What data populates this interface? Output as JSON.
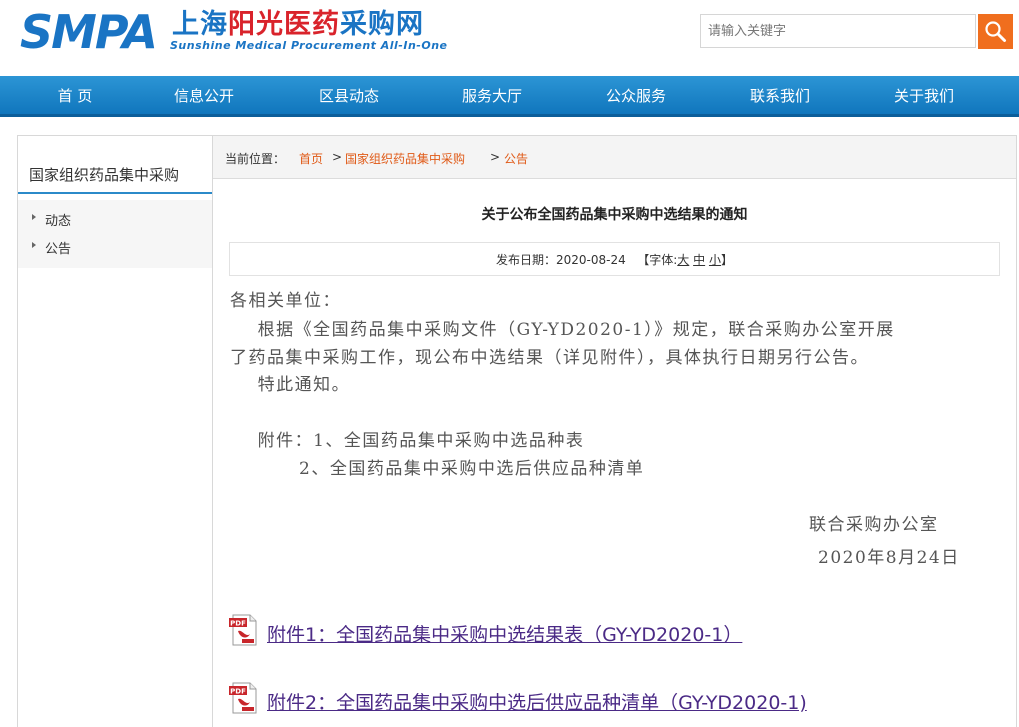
{
  "header": {
    "logo_smpa": "SMPA",
    "logo_cn_part1": "上海",
    "logo_cn_part2": "阳光医药",
    "logo_cn_part3": "采购网",
    "logo_en": "Sunshine Medical Procurement All-In-One",
    "search_placeholder": "请输入关键字",
    "colors": {
      "brand_blue": "#1a74c4",
      "accent_orange": "#f06e1e"
    }
  },
  "nav": {
    "items": [
      "首 页",
      "信息公开",
      "区县动态",
      "服务大厅",
      "公众服务",
      "联系我们",
      "关于我们"
    ]
  },
  "sidebar": {
    "title": "国家组织药品集中采购",
    "items": [
      "动态",
      "公告"
    ]
  },
  "breadcrumb": {
    "prefix": "当前位置：",
    "items": [
      "首页",
      "国家组织药品集中采购",
      "公告"
    ],
    "separator": ">"
  },
  "article": {
    "title": "关于公布全国药品集中采购中选结果的通知",
    "meta_date": "发布日期：2020-08-24",
    "font_label_open": "【字体:",
    "font_large": "大",
    "font_medium": "中",
    "font_small": "小",
    "font_label_close": "】",
    "lines": [
      "各相关单位：",
      "    根据《全国药品集中采购文件（GY-YD2020-1）》规定，联合采购办公室开展",
      "了药品集中采购工作，现公布中选结果（详见附件），具体执行日期另行公告。",
      "    特此通知。",
      "    附件：1、全国药品集中采购中选品种表",
      "          2、全国药品集中采购中选后供应品种清单",
      "联合采购办公室",
      "2020年8月24日"
    ],
    "attachments": [
      "附件1：全国药品集中采购中选结果表（GY-YD2020-1）",
      "附件2：全国药品集中采购中选后供应品种清单（GY-YD2020-1)"
    ],
    "pdf_icon_text": "PDF"
  }
}
